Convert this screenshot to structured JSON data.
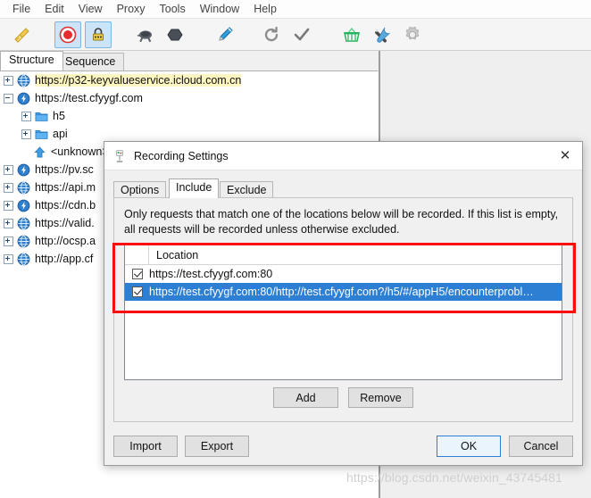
{
  "app": {
    "menu": [
      "File",
      "Edit",
      "View",
      "Proxy",
      "Tools",
      "Window",
      "Help"
    ],
    "toolbar": [
      {
        "name": "clear-icon",
        "label": "Clear"
      },
      {
        "name": "record-icon",
        "label": "Start/Stop Recording",
        "selected": true
      },
      {
        "name": "ssl-proxy-icon",
        "label": "Enable SSL Proxying",
        "selected": true
      },
      {
        "name": "throttle-icon",
        "label": "Start/Stop Throttling"
      },
      {
        "name": "breakpoints-icon",
        "label": "Enable Breakpoints"
      },
      {
        "name": "compose-icon",
        "label": "Compose"
      },
      {
        "name": "repeat-icon",
        "label": "Repeat"
      },
      {
        "name": "validate-icon",
        "label": "Validate"
      },
      {
        "name": "tools-basket-icon",
        "label": "Tools"
      },
      {
        "name": "settings-tools-icon",
        "label": "Settings"
      },
      {
        "name": "gear-icon",
        "label": "Preferences"
      }
    ],
    "view_tabs": [
      {
        "label": "Structure",
        "active": true
      },
      {
        "label": "Sequence",
        "active": false
      }
    ],
    "tree": [
      {
        "label": "https://p32-keyvalueservice.icloud.com.cn",
        "indent": 0,
        "toggle": "plus",
        "icon": "globe-icon",
        "highlight": true
      },
      {
        "label": "https://test.cfyygf.com",
        "indent": 0,
        "toggle": "minus",
        "icon": "lightning-icon",
        "highlight": false
      },
      {
        "label": "h5",
        "indent": 1,
        "toggle": "plus",
        "icon": "folder-icon",
        "highlight": false
      },
      {
        "label": "api",
        "indent": 1,
        "toggle": "plus",
        "icon": "folder-icon",
        "highlight": false
      },
      {
        "label": "<unknown>",
        "indent": 1,
        "toggle": "none",
        "icon": "up-arrow-icon",
        "highlight": false
      },
      {
        "label": "https://pv.sc",
        "indent": 0,
        "toggle": "plus",
        "icon": "lightning-icon",
        "highlight": false
      },
      {
        "label": "https://api.m",
        "indent": 0,
        "toggle": "plus",
        "icon": "globe-icon",
        "highlight": false
      },
      {
        "label": "https://cdn.b",
        "indent": 0,
        "toggle": "plus",
        "icon": "lightning-icon",
        "highlight": false
      },
      {
        "label": "https://valid.",
        "indent": 0,
        "toggle": "plus",
        "icon": "globe-icon",
        "highlight": false
      },
      {
        "label": "http://ocsp.a",
        "indent": 0,
        "toggle": "plus",
        "icon": "globe-icon",
        "highlight": false
      },
      {
        "label": "http://app.cf",
        "indent": 0,
        "toggle": "plus",
        "icon": "globe-icon",
        "highlight": false
      }
    ]
  },
  "dialog": {
    "title": "Recording Settings",
    "close_label": "✕",
    "tabs": [
      {
        "label": "Options",
        "active": false
      },
      {
        "label": "Include",
        "active": true
      },
      {
        "label": "Exclude",
        "active": false
      }
    ],
    "description": "Only requests that match one of the locations below will be recorded. If this list is empty, all requests will be recorded unless otherwise excluded.",
    "list": {
      "header": "Location",
      "rows": [
        {
          "checked": true,
          "location": "https://test.cfyygf.com:80",
          "selected": false
        },
        {
          "checked": true,
          "location": "https://test.cfyygf.com:80/http://test.cfyygf.com?/h5/#/appH5/encounterprobl…",
          "selected": true
        }
      ]
    },
    "list_buttons": [
      {
        "name": "add-button",
        "label": "Add"
      },
      {
        "name": "remove-button",
        "label": "Remove"
      }
    ],
    "footer_left": [
      {
        "name": "import-button",
        "label": "Import"
      },
      {
        "name": "export-button",
        "label": "Export"
      }
    ],
    "footer_right": [
      {
        "name": "ok-button",
        "label": "OK",
        "default": true
      },
      {
        "name": "cancel-button",
        "label": "Cancel",
        "default": false
      }
    ]
  },
  "annotation": {
    "color": "#fc0d0d"
  },
  "watermark": "https://blog.csdn.net/weixin_43745481"
}
